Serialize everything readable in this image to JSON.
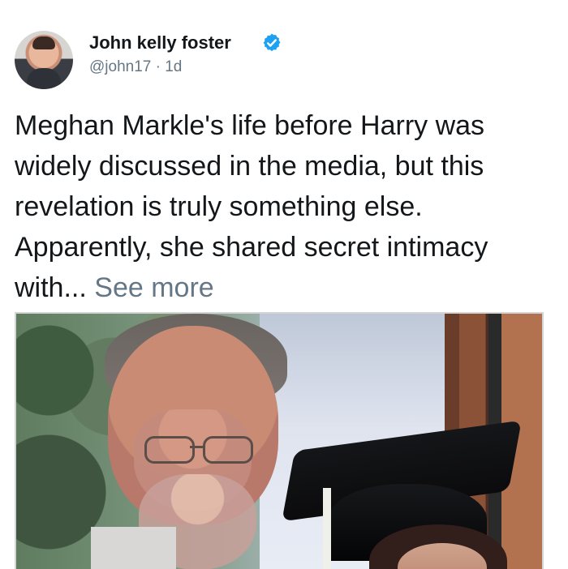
{
  "post": {
    "author": "John kelly foster",
    "handle": "@john17",
    "time": "1d",
    "text": "Meghan Markle's life before Harry was widely discussed in the media, but this revelation is truly something else. Apparently, she shared secret intimacy with...",
    "see_more": "See more"
  },
  "icons": {
    "verified": "verified-badge-icon"
  },
  "colors": {
    "name": "#14171a",
    "meta": "#657786",
    "verified": "#1da1f2",
    "see_more": "#657786"
  }
}
